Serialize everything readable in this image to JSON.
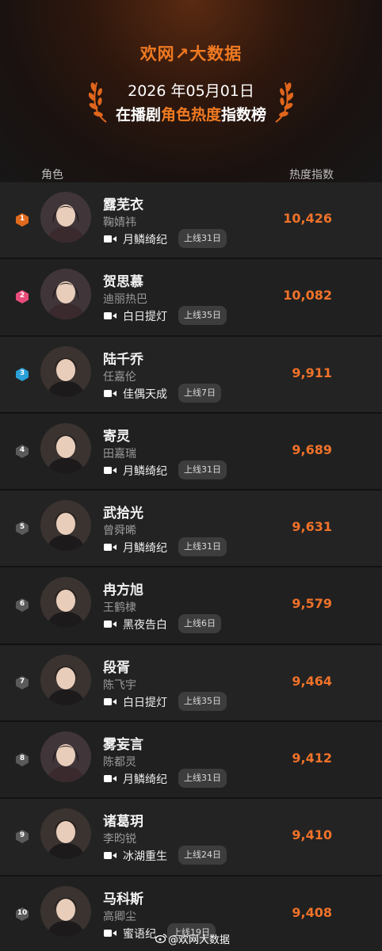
{
  "header": {
    "brand_prefix": "欢网",
    "brand_suffix": "大数据",
    "date": "2026 年05月01日",
    "title_pre": "在播剧",
    "title_highlight": "角色热度",
    "title_post": "指数榜",
    "accent_color": "#f07a22"
  },
  "columns": {
    "role": "角色",
    "index": "热度指数"
  },
  "rows": [
    {
      "rank": "1",
      "role": "露芜衣",
      "actor": "鞠婧祎",
      "show": "月鳞绮纪",
      "days": "上线31日",
      "score": "10,426",
      "rank_color": "#e06a1e",
      "avatar_icon": "portrait-female-icon"
    },
    {
      "rank": "2",
      "role": "贺思慕",
      "actor": "迪丽热巴",
      "show": "白日提灯",
      "days": "上线35日",
      "score": "10,082",
      "rank_color": "#e84c7a",
      "avatar_icon": "portrait-female-icon"
    },
    {
      "rank": "3",
      "role": "陆千乔",
      "actor": "任嘉伦",
      "show": "佳偶天成",
      "days": "上线7日",
      "score": "9,911",
      "rank_color": "#2a9fd8",
      "avatar_icon": "portrait-male-icon"
    },
    {
      "rank": "4",
      "role": "寄灵",
      "actor": "田嘉瑞",
      "show": "月鳞绮纪",
      "days": "上线31日",
      "score": "9,689",
      "rank_color": "#5a5a5a",
      "avatar_icon": "portrait-male-icon"
    },
    {
      "rank": "5",
      "role": "武拾光",
      "actor": "曾舜晞",
      "show": "月鳞绮纪",
      "days": "上线31日",
      "score": "9,631",
      "rank_color": "#5a5a5a",
      "avatar_icon": "portrait-male-icon"
    },
    {
      "rank": "6",
      "role": "冉方旭",
      "actor": "王鹤棣",
      "show": "黑夜告白",
      "days": "上线6日",
      "score": "9,579",
      "rank_color": "#5a5a5a",
      "avatar_icon": "portrait-male-icon"
    },
    {
      "rank": "7",
      "role": "段胥",
      "actor": "陈飞宇",
      "show": "白日提灯",
      "days": "上线35日",
      "score": "9,464",
      "rank_color": "#5a5a5a",
      "avatar_icon": "portrait-male-icon"
    },
    {
      "rank": "8",
      "role": "雾妄言",
      "actor": "陈都灵",
      "show": "月鳞绮纪",
      "days": "上线31日",
      "score": "9,412",
      "rank_color": "#5a5a5a",
      "avatar_icon": "portrait-female-icon"
    },
    {
      "rank": "9",
      "role": "诸葛玥",
      "actor": "李昀锐",
      "show": "冰湖重生",
      "days": "上线24日",
      "score": "9,410",
      "rank_color": "#5a5a5a",
      "avatar_icon": "portrait-male-icon"
    },
    {
      "rank": "10",
      "role": "马科斯",
      "actor": "高卿尘",
      "show": "蜜语纪",
      "days": "上线19日",
      "score": "9,408",
      "rank_color": "#5a5a5a",
      "avatar_icon": "portrait-male-icon"
    }
  ],
  "watermark": "@欢网大数据"
}
